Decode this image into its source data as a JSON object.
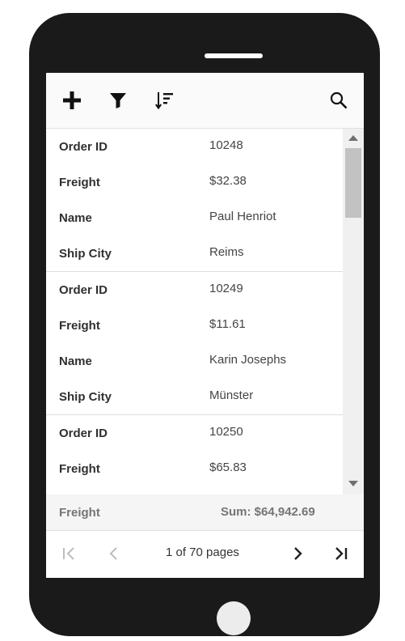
{
  "toolbar": {
    "icons": [
      "add-icon",
      "filter-icon",
      "sort-icon",
      "search-icon"
    ]
  },
  "records": [
    {
      "fields": [
        {
          "label": "Order ID",
          "value": "10248"
        },
        {
          "label": "Freight",
          "value": "$32.38"
        },
        {
          "label": "Name",
          "value": "Paul Henriot"
        },
        {
          "label": "Ship City",
          "value": "Reims"
        }
      ]
    },
    {
      "fields": [
        {
          "label": "Order ID",
          "value": "10249"
        },
        {
          "label": "Freight",
          "value": "$11.61"
        },
        {
          "label": "Name",
          "value": "Karin Josephs"
        },
        {
          "label": "Ship City",
          "value": "Münster"
        }
      ]
    },
    {
      "fields": [
        {
          "label": "Order ID",
          "value": "10250"
        },
        {
          "label": "Freight",
          "value": "$65.83"
        }
      ]
    }
  ],
  "summary": {
    "label": "Freight",
    "value": "Sum: $64,942.69"
  },
  "pager": {
    "info": "1 of 70 pages"
  },
  "colors": {
    "device": "#1a1a1a",
    "toolbar_bg": "#fafafa",
    "summary_bg": "#f5f5f5",
    "disabled_icon": "#bdbdbd",
    "active_icon": "#212121"
  }
}
